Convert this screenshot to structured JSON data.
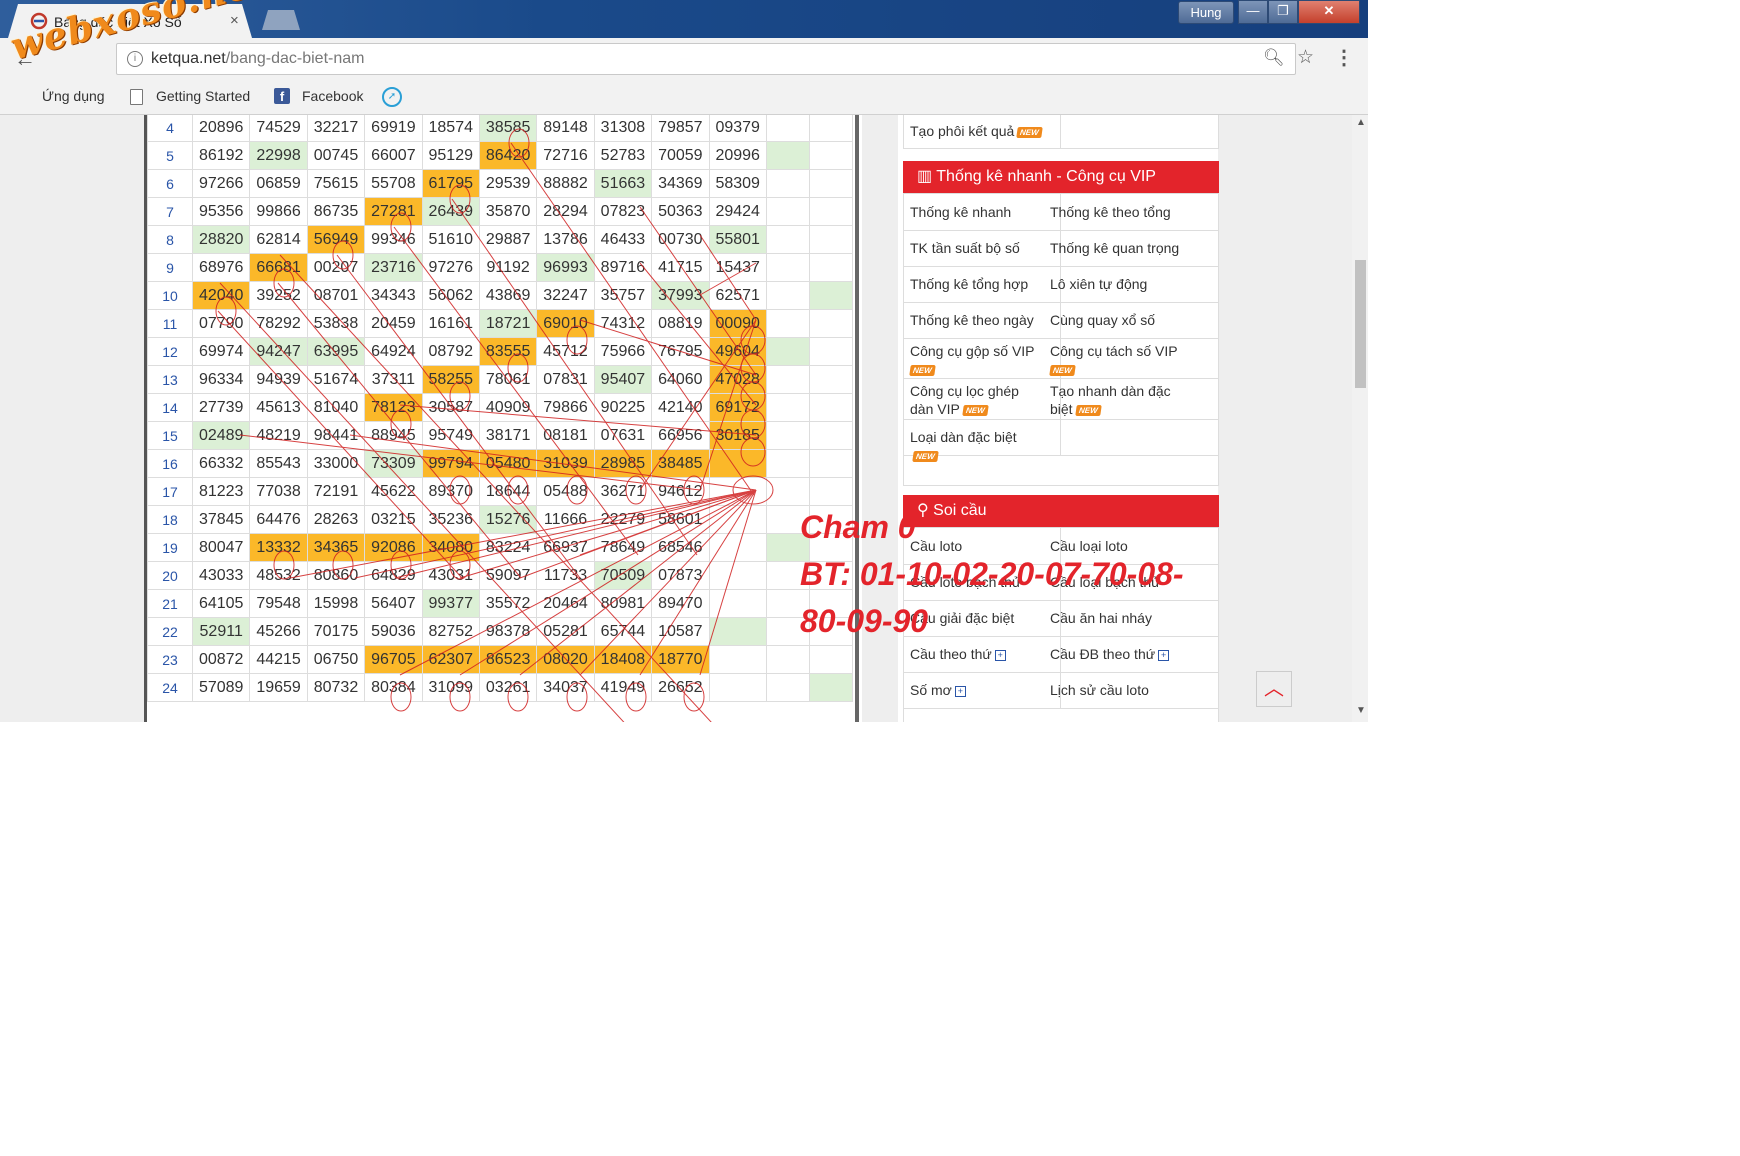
{
  "browser": {
    "tab_title": "Bảng đặc biệt Xổ Số",
    "tab_close": "×",
    "user": "Hung",
    "url_domain": "ketqua.net",
    "url_path": "/bang-dac-biet-nam",
    "bookmarks": [
      "Ứng dụng",
      "Getting Started",
      "Facebook"
    ]
  },
  "watermark": "webxoso.net",
  "table": {
    "rows": [
      {
        "idx": "4",
        "cells": [
          [
            "20896",
            ""
          ],
          [
            "74529",
            ""
          ],
          [
            "32217",
            ""
          ],
          [
            "69919",
            ""
          ],
          [
            "18574",
            ""
          ],
          [
            "38585",
            "g"
          ],
          [
            "89148",
            ""
          ],
          [
            "31308",
            ""
          ],
          [
            "79857",
            ""
          ],
          [
            "09379",
            ""
          ],
          [
            "",
            ""
          ],
          [
            "",
            ""
          ]
        ]
      },
      {
        "idx": "5",
        "cells": [
          [
            "86192",
            ""
          ],
          [
            "22998",
            "g"
          ],
          [
            "00745",
            ""
          ],
          [
            "66007",
            ""
          ],
          [
            "95129",
            ""
          ],
          [
            "86420",
            "y"
          ],
          [
            "72716",
            ""
          ],
          [
            "52783",
            ""
          ],
          [
            "70059",
            ""
          ],
          [
            "20996",
            ""
          ],
          [
            "",
            "g"
          ],
          [
            "",
            ""
          ]
        ]
      },
      {
        "idx": "6",
        "cells": [
          [
            "97266",
            ""
          ],
          [
            "06859",
            ""
          ],
          [
            "75615",
            ""
          ],
          [
            "55708",
            ""
          ],
          [
            "61795",
            "y"
          ],
          [
            "29539",
            ""
          ],
          [
            "88882",
            ""
          ],
          [
            "51663",
            "g"
          ],
          [
            "34369",
            ""
          ],
          [
            "58309",
            ""
          ],
          [
            "",
            ""
          ],
          [
            "",
            ""
          ]
        ]
      },
      {
        "idx": "7",
        "cells": [
          [
            "95356",
            ""
          ],
          [
            "99866",
            ""
          ],
          [
            "86735",
            ""
          ],
          [
            "27281",
            "y"
          ],
          [
            "26439",
            "g"
          ],
          [
            "35870",
            ""
          ],
          [
            "28294",
            ""
          ],
          [
            "07823",
            ""
          ],
          [
            "50363",
            ""
          ],
          [
            "29424",
            ""
          ],
          [
            "",
            ""
          ],
          [
            "",
            ""
          ]
        ]
      },
      {
        "idx": "8",
        "cells": [
          [
            "28820",
            "g"
          ],
          [
            "62814",
            ""
          ],
          [
            "56949",
            "y"
          ],
          [
            "99346",
            ""
          ],
          [
            "51610",
            ""
          ],
          [
            "29887",
            ""
          ],
          [
            "13786",
            ""
          ],
          [
            "46433",
            ""
          ],
          [
            "00730",
            ""
          ],
          [
            "55801",
            "g"
          ],
          [
            "",
            ""
          ],
          [
            "",
            ""
          ]
        ]
      },
      {
        "idx": "9",
        "cells": [
          [
            "68976",
            ""
          ],
          [
            "66681",
            "y"
          ],
          [
            "00207",
            ""
          ],
          [
            "23716",
            "g"
          ],
          [
            "97276",
            ""
          ],
          [
            "91192",
            ""
          ],
          [
            "96993",
            "g"
          ],
          [
            "89716",
            ""
          ],
          [
            "41715",
            ""
          ],
          [
            "15437",
            ""
          ],
          [
            "",
            ""
          ],
          [
            "",
            ""
          ]
        ]
      },
      {
        "idx": "10",
        "cells": [
          [
            "42040",
            "y"
          ],
          [
            "39252",
            ""
          ],
          [
            "08701",
            ""
          ],
          [
            "34343",
            ""
          ],
          [
            "56062",
            ""
          ],
          [
            "43869",
            ""
          ],
          [
            "32247",
            ""
          ],
          [
            "35757",
            ""
          ],
          [
            "37993",
            "g"
          ],
          [
            "62571",
            ""
          ],
          [
            "",
            ""
          ],
          [
            "",
            "g"
          ]
        ]
      },
      {
        "idx": "11",
        "cells": [
          [
            "07790",
            ""
          ],
          [
            "78292",
            ""
          ],
          [
            "53838",
            ""
          ],
          [
            "20459",
            ""
          ],
          [
            "16161",
            ""
          ],
          [
            "18721",
            "g"
          ],
          [
            "69010",
            "y"
          ],
          [
            "74312",
            ""
          ],
          [
            "08819",
            ""
          ],
          [
            "00090",
            "y"
          ],
          [
            "",
            ""
          ],
          [
            "",
            ""
          ]
        ]
      },
      {
        "idx": "12",
        "cells": [
          [
            "69974",
            ""
          ],
          [
            "94247",
            "g"
          ],
          [
            "63995",
            "g"
          ],
          [
            "64924",
            ""
          ],
          [
            "08792",
            ""
          ],
          [
            "83555",
            "y"
          ],
          [
            "45712",
            ""
          ],
          [
            "75966",
            ""
          ],
          [
            "76795",
            ""
          ],
          [
            "49604",
            "y"
          ],
          [
            "",
            "g"
          ],
          [
            "",
            ""
          ]
        ]
      },
      {
        "idx": "13",
        "cells": [
          [
            "96334",
            ""
          ],
          [
            "94939",
            ""
          ],
          [
            "51674",
            ""
          ],
          [
            "37311",
            ""
          ],
          [
            "58255",
            "y"
          ],
          [
            "78061",
            ""
          ],
          [
            "07831",
            ""
          ],
          [
            "95407",
            "g"
          ],
          [
            "64060",
            ""
          ],
          [
            "47028",
            "y"
          ],
          [
            "",
            ""
          ],
          [
            "",
            ""
          ]
        ]
      },
      {
        "idx": "14",
        "cells": [
          [
            "27739",
            ""
          ],
          [
            "45613",
            ""
          ],
          [
            "81040",
            ""
          ],
          [
            "78123",
            "y"
          ],
          [
            "30587",
            ""
          ],
          [
            "40909",
            ""
          ],
          [
            "79866",
            ""
          ],
          [
            "90225",
            ""
          ],
          [
            "42140",
            ""
          ],
          [
            "69172",
            "y"
          ],
          [
            "",
            ""
          ],
          [
            "",
            ""
          ]
        ]
      },
      {
        "idx": "15",
        "cells": [
          [
            "02489",
            "g"
          ],
          [
            "48219",
            ""
          ],
          [
            "98441",
            ""
          ],
          [
            "88945",
            ""
          ],
          [
            "95749",
            ""
          ],
          [
            "38171",
            ""
          ],
          [
            "08181",
            ""
          ],
          [
            "07631",
            ""
          ],
          [
            "66956",
            ""
          ],
          [
            "30185",
            "y"
          ],
          [
            "",
            ""
          ],
          [
            "",
            ""
          ]
        ]
      },
      {
        "idx": "16",
        "cells": [
          [
            "66332",
            ""
          ],
          [
            "85543",
            ""
          ],
          [
            "33000",
            ""
          ],
          [
            "73309",
            "g"
          ],
          [
            "99794",
            "y"
          ],
          [
            "05480",
            "y"
          ],
          [
            "31039",
            "y"
          ],
          [
            "28985",
            "y"
          ],
          [
            "38485",
            "y"
          ],
          [
            "",
            "y"
          ],
          [
            "",
            ""
          ],
          [
            "",
            ""
          ]
        ]
      },
      {
        "idx": "17",
        "cells": [
          [
            "81223",
            ""
          ],
          [
            "77038",
            ""
          ],
          [
            "72191",
            ""
          ],
          [
            "45622",
            ""
          ],
          [
            "89370",
            ""
          ],
          [
            "18644",
            ""
          ],
          [
            "05488",
            ""
          ],
          [
            "36271",
            ""
          ],
          [
            "94612",
            ""
          ],
          [
            "",
            ""
          ],
          [
            "",
            ""
          ],
          [
            "",
            ""
          ]
        ]
      },
      {
        "idx": "18",
        "cells": [
          [
            "37845",
            ""
          ],
          [
            "64476",
            ""
          ],
          [
            "28263",
            ""
          ],
          [
            "03215",
            ""
          ],
          [
            "35236",
            ""
          ],
          [
            "15276",
            "g"
          ],
          [
            "11666",
            ""
          ],
          [
            "22279",
            ""
          ],
          [
            "58601",
            ""
          ],
          [
            "",
            ""
          ],
          [
            "",
            ""
          ],
          [
            "",
            ""
          ]
        ]
      },
      {
        "idx": "19",
        "cells": [
          [
            "80047",
            ""
          ],
          [
            "13332",
            "y"
          ],
          [
            "34365",
            "y"
          ],
          [
            "92086",
            "y"
          ],
          [
            "34080",
            "y"
          ],
          [
            "83224",
            ""
          ],
          [
            "66937",
            ""
          ],
          [
            "78649",
            ""
          ],
          [
            "68546",
            ""
          ],
          [
            "",
            ""
          ],
          [
            "",
            "g"
          ],
          [
            "",
            ""
          ]
        ]
      },
      {
        "idx": "20",
        "cells": [
          [
            "43033",
            ""
          ],
          [
            "48532",
            ""
          ],
          [
            "80860",
            ""
          ],
          [
            "64829",
            ""
          ],
          [
            "43031",
            ""
          ],
          [
            "59097",
            ""
          ],
          [
            "11733",
            ""
          ],
          [
            "70509",
            "g"
          ],
          [
            "07873",
            ""
          ],
          [
            "",
            ""
          ],
          [
            "",
            ""
          ],
          [
            "",
            ""
          ]
        ]
      },
      {
        "idx": "21",
        "cells": [
          [
            "64105",
            ""
          ],
          [
            "79548",
            ""
          ],
          [
            "15998",
            ""
          ],
          [
            "56407",
            ""
          ],
          [
            "99377",
            "g"
          ],
          [
            "35572",
            ""
          ],
          [
            "20464",
            ""
          ],
          [
            "80981",
            ""
          ],
          [
            "89470",
            ""
          ],
          [
            "",
            ""
          ],
          [
            "",
            ""
          ],
          [
            "",
            ""
          ]
        ]
      },
      {
        "idx": "22",
        "cells": [
          [
            "52911",
            "g"
          ],
          [
            "45266",
            ""
          ],
          [
            "70175",
            ""
          ],
          [
            "59036",
            ""
          ],
          [
            "82752",
            ""
          ],
          [
            "98378",
            ""
          ],
          [
            "05281",
            ""
          ],
          [
            "65744",
            ""
          ],
          [
            "10587",
            ""
          ],
          [
            "",
            "g"
          ],
          [
            "",
            ""
          ],
          [
            "",
            ""
          ]
        ]
      },
      {
        "idx": "23",
        "cells": [
          [
            "00872",
            ""
          ],
          [
            "44215",
            ""
          ],
          [
            "06750",
            ""
          ],
          [
            "96705",
            "y"
          ],
          [
            "62307",
            "y"
          ],
          [
            "86523",
            "y"
          ],
          [
            "08020",
            "y"
          ],
          [
            "18408",
            "y"
          ],
          [
            "18770",
            "y"
          ],
          [
            "",
            ""
          ],
          [
            "",
            ""
          ],
          [
            "",
            ""
          ]
        ]
      },
      {
        "idx": "24",
        "cells": [
          [
            "57089",
            ""
          ],
          [
            "19659",
            ""
          ],
          [
            "80732",
            ""
          ],
          [
            "80384",
            ""
          ],
          [
            "31099",
            ""
          ],
          [
            "03261",
            ""
          ],
          [
            "34037",
            ""
          ],
          [
            "41949",
            ""
          ],
          [
            "26652",
            ""
          ],
          [
            "",
            ""
          ],
          [
            "",
            ""
          ],
          [
            "",
            "g"
          ]
        ]
      }
    ]
  },
  "panel": {
    "top_row": {
      "label": "Tạo phôi kết quả",
      "badge": "NEW"
    },
    "vip_header": "Thống kê nhanh - Công cụ VIP",
    "vip_items": [
      [
        "Thống kê nhanh",
        "Thống kê theo tổng"
      ],
      [
        "TK tần suất bộ số",
        "Thống kê quan trọng"
      ],
      [
        "Thống kê tổng hợp",
        "Lô xiên tự động"
      ],
      [
        "Thống kê theo ngày",
        "Cùng quay xổ số"
      ],
      [
        "Công cụ gộp số VIP",
        "Công cụ tách số VIP"
      ],
      [
        "Công cụ lọc ghép dàn VIP",
        "Tạo nhanh dàn đặc biệt"
      ],
      [
        "Loại dàn đặc biệt",
        ""
      ]
    ],
    "badge": "NEW",
    "soi_header": "Soi cầu",
    "soi_items": [
      [
        "Cầu loto",
        "Cầu loại loto"
      ],
      [
        "Cầu loto bạch thủ",
        "Cầu loại bạch thủ"
      ],
      [
        "Cầu giải đặc biệt",
        "Cầu ăn hai nháy"
      ],
      [
        "Cầu theo thứ",
        "Cầu ĐB theo thứ"
      ],
      [
        "Số mơ",
        "Lịch sử cầu loto"
      ]
    ]
  },
  "annotation": {
    "line1": "Cham 0",
    "line2": "BT: 01-10-02-20-07-70-08-",
    "line3": "80-09-90"
  }
}
